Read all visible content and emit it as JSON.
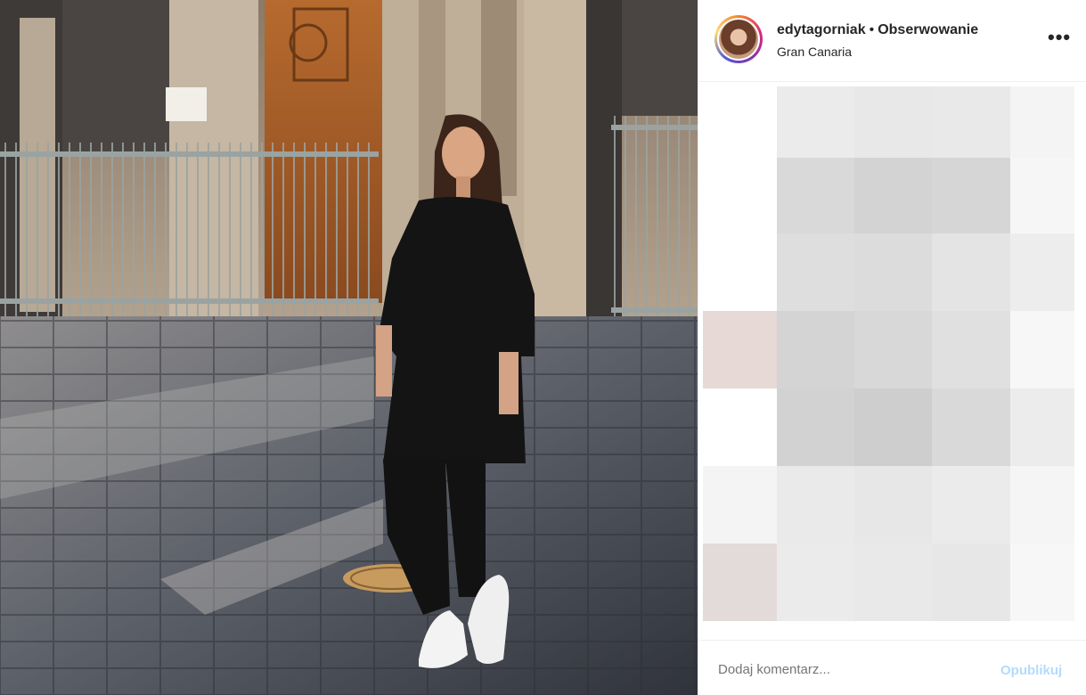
{
  "post": {
    "username": "edytagorniak",
    "separator": "•",
    "follow_label": "Obserwowanie",
    "location": "Gran Canaria",
    "more_icon": "more-horizontal-icon",
    "comment_placeholder": "Dodaj komentarz...",
    "publish_label": "Opublikuj"
  },
  "colors": {
    "publish_disabled": "#b3dbff",
    "text": "#262626",
    "border": "#efefef"
  }
}
